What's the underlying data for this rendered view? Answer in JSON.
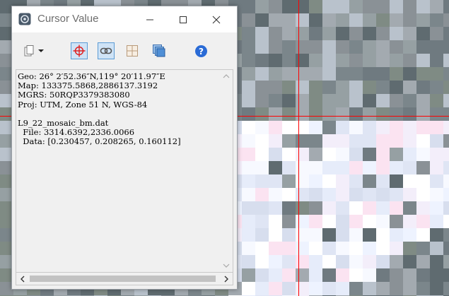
{
  "window": {
    "title": "Cursor Value"
  },
  "toolbar": {
    "buttons": [
      {
        "name": "copy-dropdown",
        "icon": "copy-icon"
      },
      {
        "name": "crosshair",
        "icon": "crosshair-icon",
        "pressed": true
      },
      {
        "name": "link",
        "icon": "link-icon",
        "pressed": true
      },
      {
        "name": "grid",
        "icon": "grid-icon"
      },
      {
        "name": "layers",
        "icon": "layers-icon"
      },
      {
        "name": "help",
        "icon": "help-icon"
      }
    ]
  },
  "readout": {
    "geo": "Geo: 26° 2′52.36″N,119° 20′11.97″E",
    "map": "Map: 133375.5868,2886137.3192",
    "mgrs": "MGRS: 50RQP3379383080",
    "proj": "Proj: UTM, Zone 51 N, WGS-84",
    "dataset": "L9_22_mosaic_bm.dat",
    "file": "  File: 3314.6392,2336.0066",
    "data": "  Data: [0.230457, 0.208265, 0.160112]"
  },
  "colors": {
    "crosshair": "#ff0000",
    "toolbar_accent": "#2a6bd6",
    "pressed_fill": "#cfe3f6"
  }
}
